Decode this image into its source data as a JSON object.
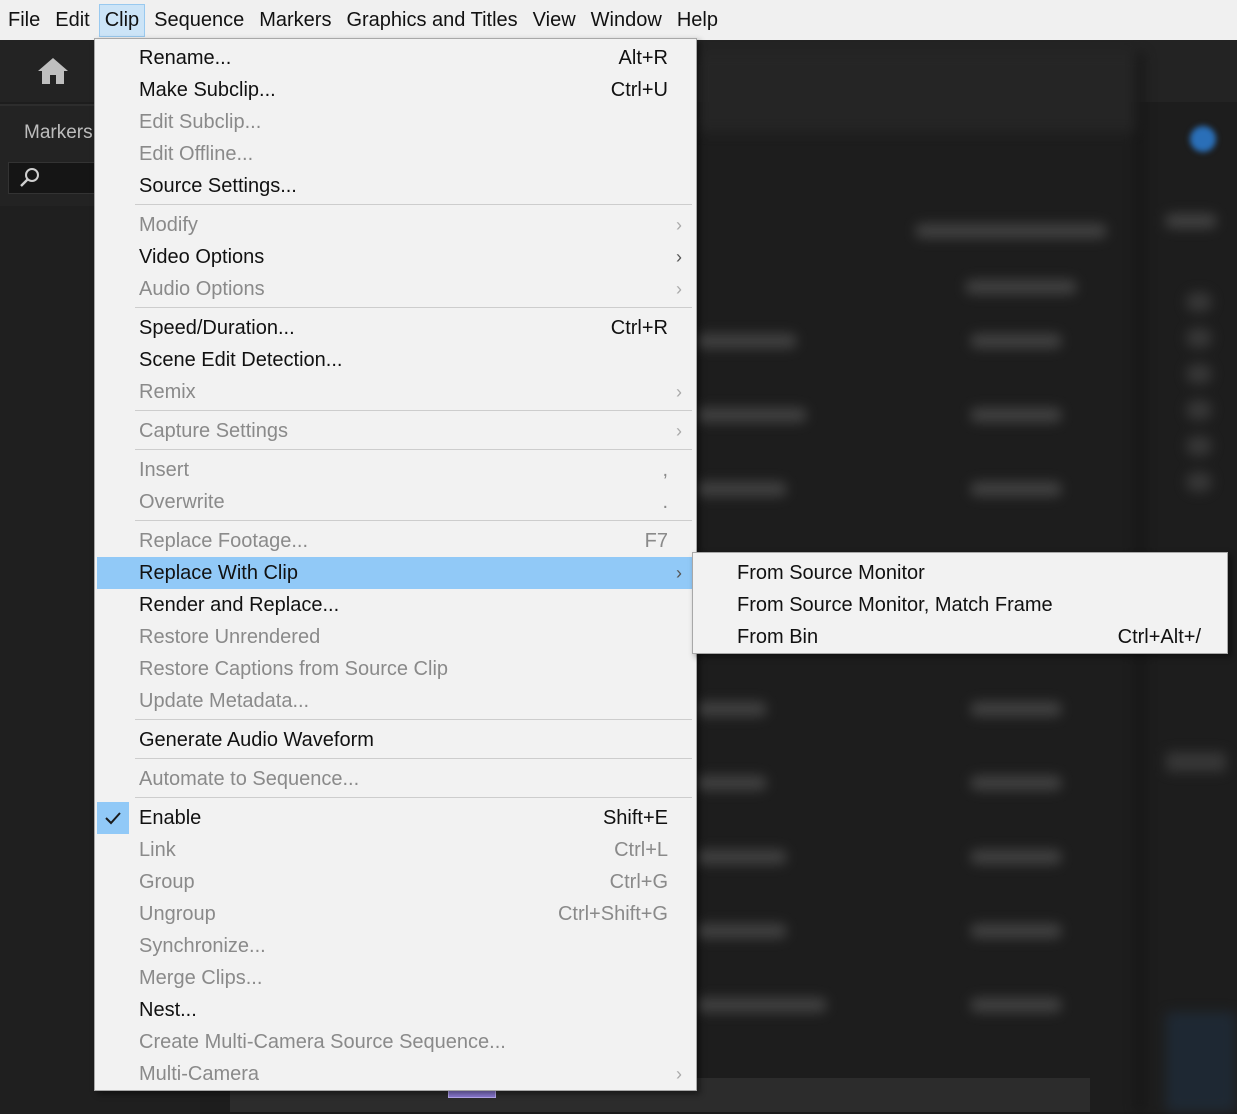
{
  "menubar": {
    "items": [
      "File",
      "Edit",
      "Clip",
      "Sequence",
      "Markers",
      "Graphics and Titles",
      "View",
      "Window",
      "Help"
    ],
    "active_item": "Clip"
  },
  "left_panel": {
    "tab_label": "Markers"
  },
  "icons": {
    "home": "home-icon",
    "search": "search-icon",
    "check": "check-icon",
    "submenu_arrow": "chevron-right-icon"
  },
  "colors": {
    "highlight": "#91c9f7",
    "menu_bg": "#f2f2f2",
    "disabled_text": "#8a8a8a",
    "app_bg": "#1d1d1d"
  },
  "clip_menu": {
    "items": [
      {
        "label": "Rename...",
        "shortcut": "Alt+R",
        "enabled": true
      },
      {
        "label": "Make Subclip...",
        "shortcut": "Ctrl+U",
        "enabled": true
      },
      {
        "label": "Edit Subclip...",
        "shortcut": "",
        "enabled": false
      },
      {
        "label": "Edit Offline...",
        "shortcut": "",
        "enabled": false
      },
      {
        "label": "Source Settings...",
        "shortcut": "",
        "enabled": true
      },
      {
        "label": "Modify",
        "shortcut": "",
        "enabled": false,
        "submenu": true
      },
      {
        "label": "Video Options",
        "shortcut": "",
        "enabled": true,
        "submenu": true
      },
      {
        "label": "Audio Options",
        "shortcut": "",
        "enabled": false,
        "submenu": true
      },
      {
        "label": "Speed/Duration...",
        "shortcut": "Ctrl+R",
        "enabled": true
      },
      {
        "label": "Scene Edit Detection...",
        "shortcut": "",
        "enabled": true
      },
      {
        "label": "Remix",
        "shortcut": "",
        "enabled": false,
        "submenu": true
      },
      {
        "label": "Capture Settings",
        "shortcut": "",
        "enabled": false,
        "submenu": true
      },
      {
        "label": "Insert",
        "shortcut": ",",
        "enabled": false
      },
      {
        "label": "Overwrite",
        "shortcut": ".",
        "enabled": false
      },
      {
        "label": "Replace Footage...",
        "shortcut": "F7",
        "enabled": false
      },
      {
        "label": "Replace With Clip",
        "shortcut": "",
        "enabled": true,
        "submenu": true,
        "highlighted": true
      },
      {
        "label": "Render and Replace...",
        "shortcut": "",
        "enabled": true
      },
      {
        "label": "Restore Unrendered",
        "shortcut": "",
        "enabled": false
      },
      {
        "label": "Restore Captions from Source Clip",
        "shortcut": "",
        "enabled": false
      },
      {
        "label": "Update Metadata...",
        "shortcut": "",
        "enabled": false
      },
      {
        "label": "Generate Audio Waveform",
        "shortcut": "",
        "enabled": true
      },
      {
        "label": "Automate to Sequence...",
        "shortcut": "",
        "enabled": false
      },
      {
        "label": "Enable",
        "shortcut": "Shift+E",
        "enabled": true,
        "checked": true
      },
      {
        "label": "Link",
        "shortcut": "Ctrl+L",
        "enabled": false
      },
      {
        "label": "Group",
        "shortcut": "Ctrl+G",
        "enabled": false
      },
      {
        "label": "Ungroup",
        "shortcut": "Ctrl+Shift+G",
        "enabled": false
      },
      {
        "label": "Synchronize...",
        "shortcut": "",
        "enabled": false
      },
      {
        "label": "Merge Clips...",
        "shortcut": "",
        "enabled": false
      },
      {
        "label": "Nest...",
        "shortcut": "",
        "enabled": true
      },
      {
        "label": "Create Multi-Camera Source Sequence...",
        "shortcut": "",
        "enabled": false
      },
      {
        "label": "Multi-Camera",
        "shortcut": "",
        "enabled": false,
        "submenu": true
      }
    ]
  },
  "replace_submenu": {
    "items": [
      {
        "label": "From Source Monitor",
        "shortcut": ""
      },
      {
        "label": "From Source Monitor, Match Frame",
        "shortcut": ""
      },
      {
        "label": "From Bin",
        "shortcut": "Ctrl+Alt+/"
      }
    ]
  }
}
